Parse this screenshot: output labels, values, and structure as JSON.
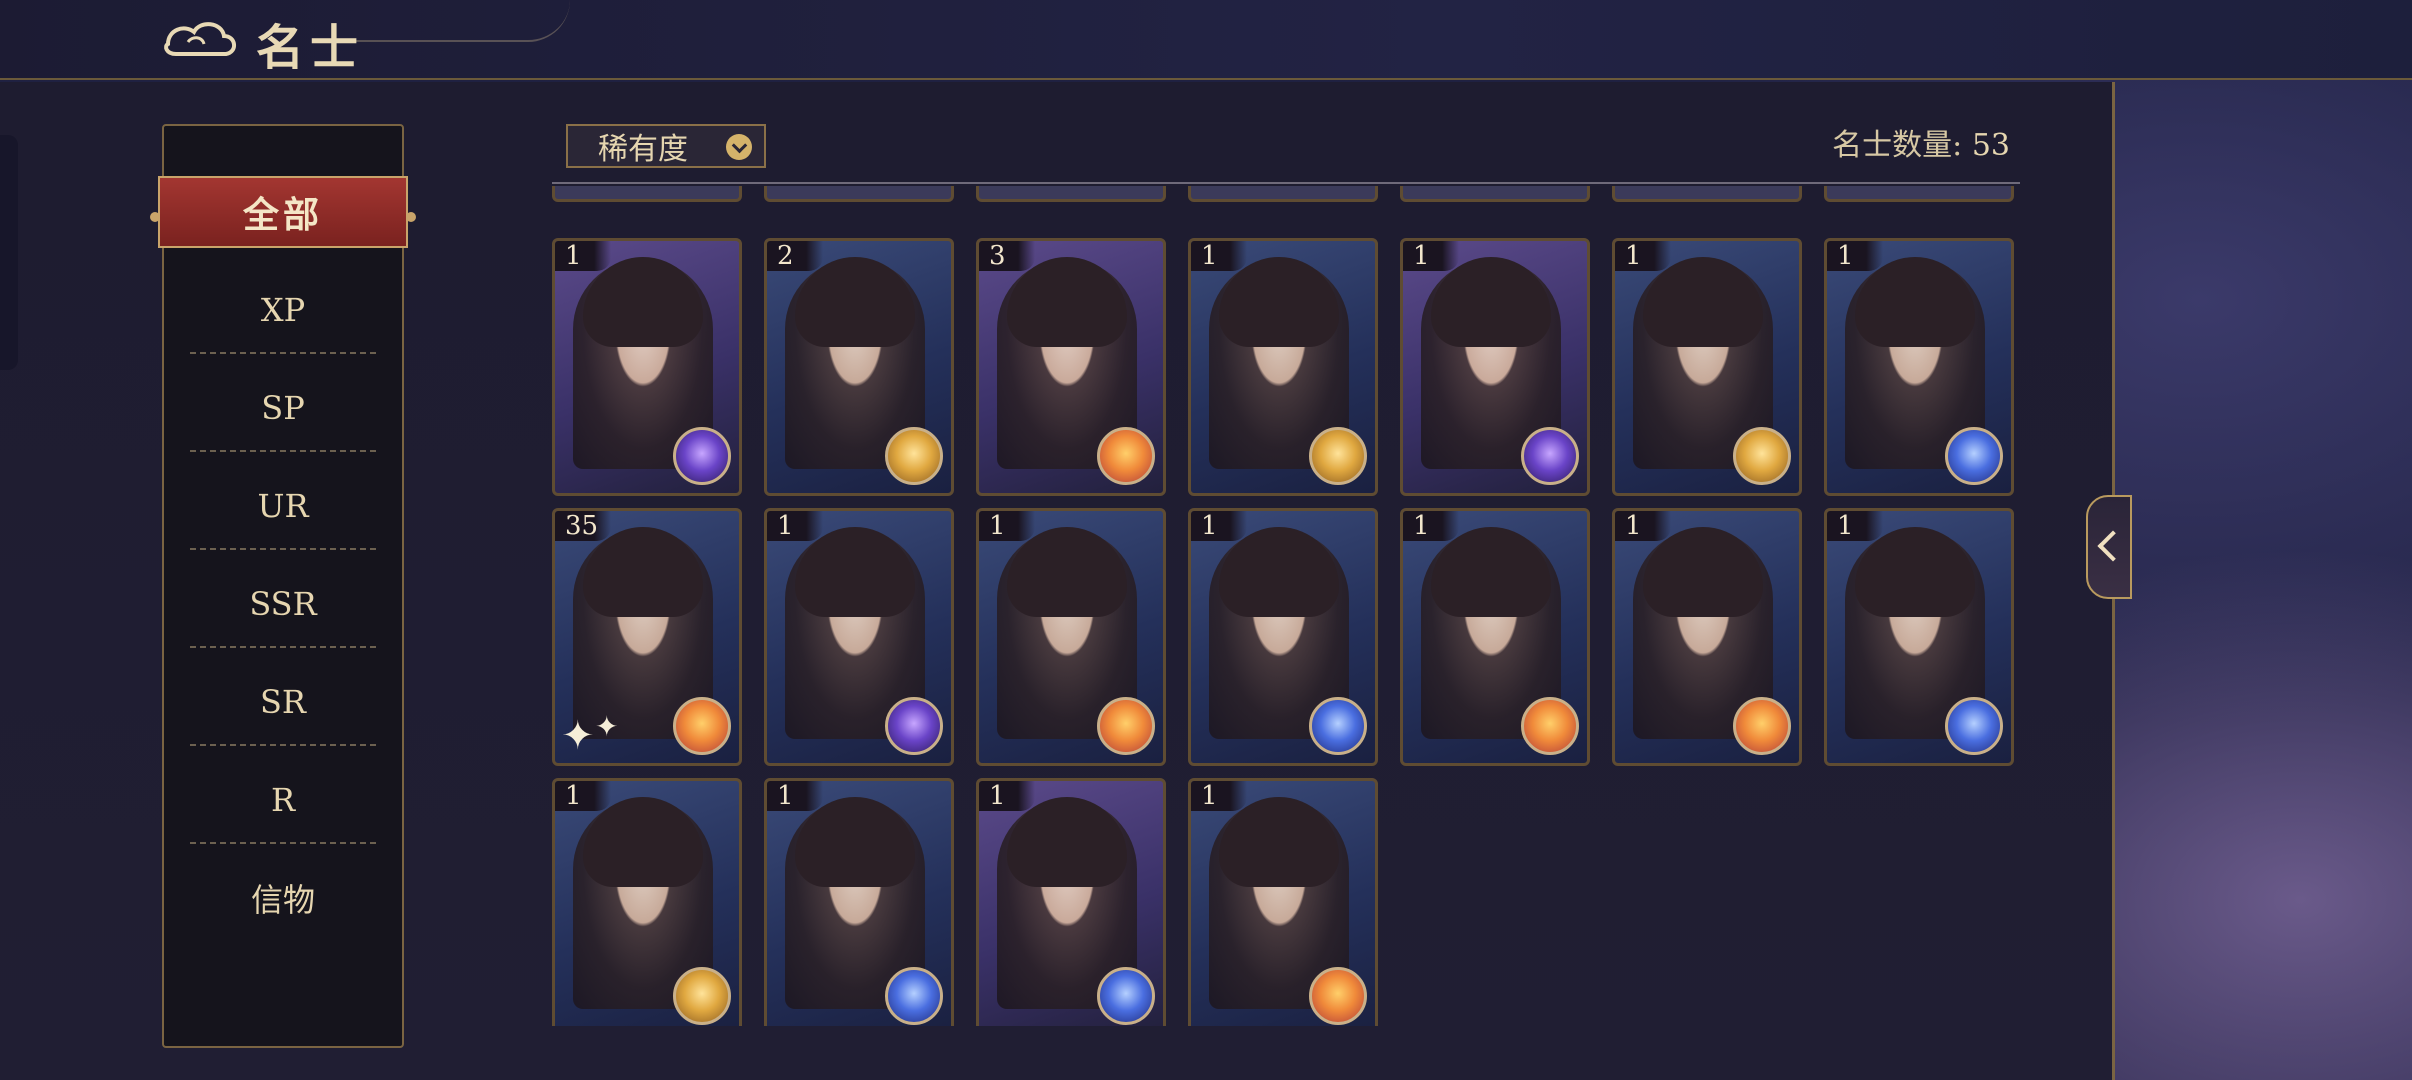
{
  "header": {
    "title": "名士"
  },
  "filters": {
    "selected": "全部",
    "items": [
      "XP",
      "SP",
      "UR",
      "SSR",
      "SR",
      "R",
      "信物"
    ]
  },
  "toolbar": {
    "sort_label": "稀有度",
    "count_label": "名士数量:",
    "count_value": "53"
  },
  "cards": [
    {
      "level": "1",
      "element": "violet-icon",
      "tone": "purple"
    },
    {
      "level": "2",
      "element": "gold-icon",
      "tone": "blue"
    },
    {
      "level": "3",
      "element": "fire-icon",
      "tone": "purple"
    },
    {
      "level": "1",
      "element": "gold-icon",
      "tone": "blue"
    },
    {
      "level": "1",
      "element": "violet-icon",
      "tone": "purple"
    },
    {
      "level": "1",
      "element": "gold-icon",
      "tone": "blue"
    },
    {
      "level": "1",
      "element": "blue-icon",
      "tone": "blue"
    },
    {
      "level": "35",
      "element": "fire-icon",
      "tone": "blue"
    },
    {
      "level": "1",
      "element": "violet-icon",
      "tone": "blue"
    },
    {
      "level": "1",
      "element": "fire-icon",
      "tone": "blue"
    },
    {
      "level": "1",
      "element": "blue-icon",
      "tone": "blue"
    },
    {
      "level": "1",
      "element": "fire-icon",
      "tone": "blue"
    },
    {
      "level": "1",
      "element": "fire-icon",
      "tone": "blue"
    },
    {
      "level": "1",
      "element": "blue-icon",
      "tone": "blue"
    },
    {
      "level": "1",
      "element": "gold-icon",
      "tone": "blue"
    },
    {
      "level": "1",
      "element": "blue-icon",
      "tone": "blue"
    },
    {
      "level": "1",
      "element": "blue-icon",
      "tone": "purple"
    },
    {
      "level": "1",
      "element": "fire-icon",
      "tone": "blue"
    }
  ]
}
